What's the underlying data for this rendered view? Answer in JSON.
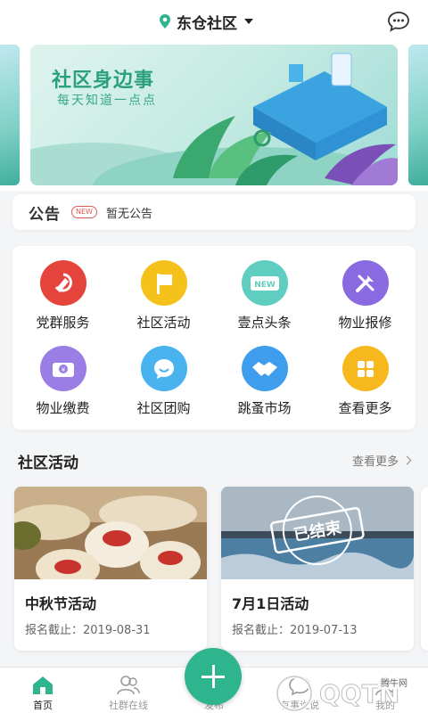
{
  "header": {
    "location": "东仓社区"
  },
  "banner": {
    "title": "社区身边事",
    "subtitle": "每天知道一点点"
  },
  "notice": {
    "logo": "公告",
    "badge": "NEW",
    "text": "暂无公告"
  },
  "services": [
    {
      "label": "党群服务",
      "icon": "party-emblem-icon",
      "color": "#e5443c"
    },
    {
      "label": "社区活动",
      "icon": "flag-icon",
      "color": "#f5c21b"
    },
    {
      "label": "壹点头条",
      "icon": "new-badge-icon",
      "color": "#5fcdc0"
    },
    {
      "label": "物业报修",
      "icon": "repair-tools-icon",
      "color": "#8a6ae0"
    },
    {
      "label": "物业缴费",
      "icon": "payment-wallet-icon",
      "color": "#9b7de6"
    },
    {
      "label": "社区团购",
      "icon": "chat-smile-icon",
      "color": "#48b3ef"
    },
    {
      "label": "跳蚤市场",
      "icon": "handshake-icon",
      "color": "#3f9ded"
    },
    {
      "label": "查看更多",
      "icon": "grid-more-icon",
      "color": "#f6b81d"
    }
  ],
  "section": {
    "title": "社区活动",
    "more": "查看更多"
  },
  "activities": [
    {
      "title": "中秋节活动",
      "date": "报名截止：2019-08-31"
    },
    {
      "title": "7月1日活动",
      "date": "报名截止：2019-07-13",
      "stamp": "已结束"
    }
  ],
  "nav": {
    "home": "首页",
    "groups": "社群在线",
    "publish": "发布",
    "message": "有事说说",
    "mine": "我的"
  },
  "watermark": {
    "brand": "QQTN",
    "small": "腾牛网"
  }
}
